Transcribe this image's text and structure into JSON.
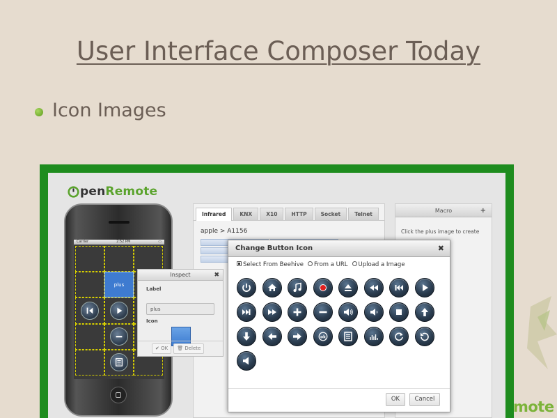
{
  "slide": {
    "title": "User Interface Composer Today",
    "bullet": "Icon Images",
    "corner_logo_text": "mote"
  },
  "app": {
    "brand": {
      "open": "pen",
      "remote": "Remote"
    },
    "phone": {
      "status_carrier": "Carrier",
      "status_time": "2:52 PM",
      "selected_button_label": "plus"
    },
    "inspect": {
      "title": "Inspect",
      "label_heading": "Label",
      "label_value": "plus",
      "icon_heading": "Icon",
      "ok": "OK",
      "delete": "Delete"
    },
    "tabs": [
      "Infrared",
      "KNX",
      "X10",
      "HTTP",
      "Socket",
      "Telnet"
    ],
    "breadcrumb": "apple > A1156",
    "commands": [
      "play",
      "plus"
    ],
    "macro": {
      "title": "Macro",
      "add": "+",
      "hint": "Click the plus image to create"
    },
    "dialog": {
      "title": "Change Button Icon",
      "close": "✖",
      "sources": [
        {
          "label": "Select From Beehive",
          "selected": true
        },
        {
          "label": "From a URL",
          "selected": false
        },
        {
          "label": "Upload a Image",
          "selected": false
        }
      ],
      "icons": [
        "power-icon",
        "home-icon",
        "music-note-icon",
        "record-icon",
        "eject-icon",
        "rewind-icon",
        "previous-track-icon",
        "play-icon",
        "next-track-icon",
        "fast-forward-icon",
        "plus-icon",
        "minus-icon",
        "volume-up-icon",
        "volume-down-icon",
        "stop-icon",
        "arrow-up-icon",
        "arrow-down-icon",
        "arrow-left-icon",
        "arrow-right-icon",
        "ok-icon",
        "menu-list-icon",
        "equalizer-icon",
        "refresh-icon",
        "undo-icon",
        "mute-icon"
      ],
      "ok": "OK",
      "cancel": "Cancel"
    }
  },
  "colors": {
    "slide_bg": "#e6dccf",
    "frame_green": "#1e8c1e",
    "brand_green": "#5aa32c",
    "selected_blue": "#3e7bd0"
  }
}
